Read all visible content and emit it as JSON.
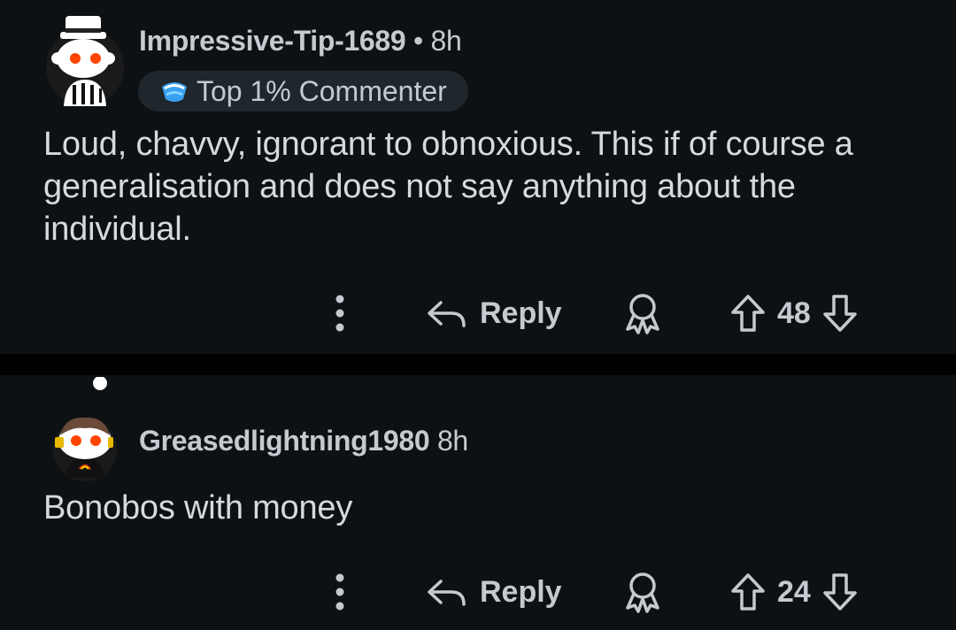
{
  "comments": [
    {
      "username": "Impressive-Tip-1689",
      "separator": "•",
      "time": "8h",
      "flair": "Top 1% Commenter",
      "body": "Loud, chavvy, ignorant to obnoxious. This if of course a generalisation and does not say anything about the individual.",
      "reply_label": "Reply",
      "score": "48"
    },
    {
      "username": "Greasedlightning1980",
      "time": "8h",
      "body": "Bonobos with money",
      "reply_label": "Reply",
      "score": "24"
    }
  ],
  "icons": {
    "more": "more-vertical-icon",
    "reply": "reply-arrow-icon",
    "award": "award-ribbon-icon",
    "upvote": "upvote-arrow-icon",
    "downvote": "downvote-arrow-icon",
    "flair": "commenter-badge-icon"
  },
  "colors": {
    "background": "#0e1113",
    "divider": "#000000",
    "text": "#d7dadc",
    "muted_text": "#c3cad0",
    "flair_bg": "#1f272c",
    "avatar_accent": "#ff4500"
  }
}
